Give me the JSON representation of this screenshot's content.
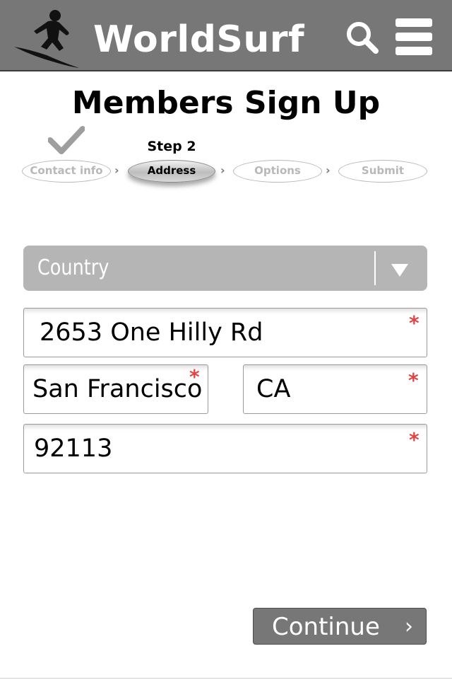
{
  "header": {
    "brand": "WorldSurf",
    "logo_icon": "surfer-logo-icon",
    "search_icon": "search-icon",
    "menu_icon": "hamburger-menu-icon",
    "background_color": "#777777"
  },
  "page": {
    "title": "Members Sign Up"
  },
  "steps": {
    "current_label": "Step 2",
    "items": [
      {
        "label": "Contact info",
        "state": "completed"
      },
      {
        "label": "Address",
        "state": "active"
      },
      {
        "label": "Options",
        "state": "upcoming"
      },
      {
        "label": "Submit",
        "state": "upcoming"
      }
    ],
    "completed_icon": "checkmark-icon",
    "separator_icon": "chevron-right-icon"
  },
  "form": {
    "country": {
      "placeholder": "Country",
      "icon": "dropdown-arrow-icon"
    },
    "street": {
      "value": "2653 One Hilly Rd",
      "required": "*"
    },
    "city": {
      "value": "San Francisco",
      "required": "*"
    },
    "state": {
      "value": "CA",
      "required": "*"
    },
    "zip": {
      "value": "92113",
      "required": "*"
    },
    "required_color": "#e24444"
  },
  "actions": {
    "continue_label": "Continue",
    "continue_icon": "chevron-right-icon"
  }
}
